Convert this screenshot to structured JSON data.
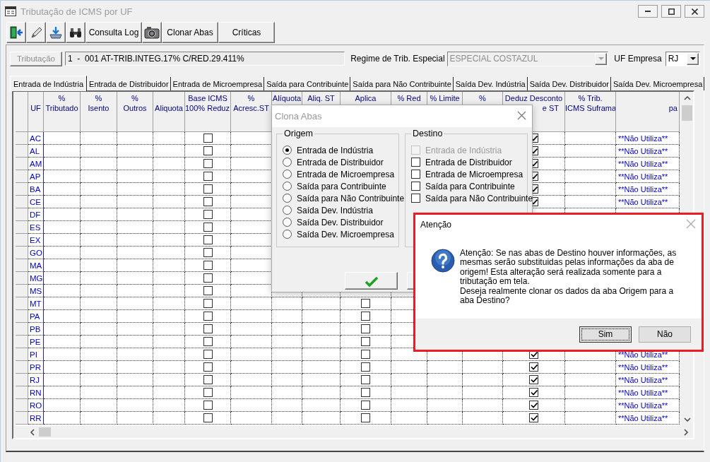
{
  "window": {
    "title": "Tributação de ICMS por UF"
  },
  "toolbar": [
    {
      "kind": "exit"
    },
    {
      "kind": "edit"
    },
    {
      "kind": "download"
    },
    {
      "kind": "binoculars"
    },
    {
      "kind": "text",
      "label": "Consulta Log"
    },
    {
      "kind": "camera"
    },
    {
      "kind": "text",
      "label": "Clonar Abas"
    },
    {
      "kind": "text",
      "label": "Críticas"
    }
  ],
  "header_fields": {
    "tributacao_button": {
      "label": "Tributação",
      "disabled": true
    },
    "tributacao_value": "1  -  001 AT-TRIB.INTEG.17% C/RED.29.411%",
    "regime_label": "Regime de Trib. Especial",
    "regime": {
      "value": "ESPECIAL COSTAZUL",
      "disabled": true
    },
    "uf_label": "UF Empresa",
    "uf": {
      "value": "RJ",
      "disabled": false
    }
  },
  "tabs": [
    {
      "label": "Entrada de Indústria",
      "selected": true
    },
    {
      "label": "Entrada de Distribuidor",
      "selected": false
    },
    {
      "label": "Entrada de Microempresa",
      "selected": false
    },
    {
      "label": "Saída para Contribuinte",
      "selected": false
    },
    {
      "label": "Saída para Não Contribuinte",
      "selected": false
    },
    {
      "label": "Saída Dev. Indústria",
      "selected": false
    },
    {
      "label": "Saída Dev. Distribuidor",
      "selected": false
    },
    {
      "label": "Saída Dev. Microempresa",
      "selected": false
    }
  ],
  "grid": {
    "columns": [
      {
        "kind": "full",
        "lines": [
          "UF"
        ]
      },
      {
        "kind": "full",
        "lines": [
          "%",
          "Tributado"
        ]
      },
      {
        "kind": "full",
        "lines": [
          "%",
          "Isento"
        ]
      },
      {
        "kind": "full",
        "lines": [
          "%",
          "Outros"
        ]
      },
      {
        "kind": "full",
        "lines": [
          "Aliquota"
        ]
      },
      {
        "kind": "full",
        "lines": [
          "Base ICMS",
          "100% Reduz."
        ]
      },
      {
        "kind": "full",
        "lines": [
          "%",
          "Acresc.ST"
        ]
      },
      {
        "kind": "cut",
        "lines": [
          "Alíquota"
        ]
      },
      {
        "kind": "cut",
        "lines": [
          "Aliq. ST"
        ]
      },
      {
        "kind": "cut",
        "lines": [
          "Aplica"
        ]
      },
      {
        "kind": "cut",
        "lines": [
          "% Red"
        ]
      },
      {
        "kind": "cut",
        "lines": [
          "% Limite"
        ]
      },
      {
        "kind": "cut",
        "lines": [
          "%"
        ]
      },
      {
        "kind": "split",
        "lines": [
          "Deduz Desconto",
          "e ST"
        ]
      },
      {
        "kind": "full",
        "lines": [
          "% Trib.",
          "ICMS Suframa"
        ]
      },
      {
        "kind": "edge",
        "lines": [
          "pa"
        ]
      }
    ],
    "rows": [
      {
        "uf": "AC",
        "base_checked": false,
        "deduz_checked": true,
        "note": "**Não Utiliza**"
      },
      {
        "uf": "AL",
        "base_checked": false,
        "deduz_checked": true,
        "note": "**Não Utiliza**"
      },
      {
        "uf": "AM",
        "base_checked": false,
        "deduz_checked": true,
        "note": "**Não Utiliza**"
      },
      {
        "uf": "AP",
        "base_checked": false,
        "deduz_checked": true,
        "note": "**Não Utiliza**"
      },
      {
        "uf": "BA",
        "base_checked": false,
        "deduz_checked": true,
        "note": "**Não Utiliza**"
      },
      {
        "uf": "CE",
        "base_checked": false,
        "deduz_checked": true,
        "note": "**Não Utiliza**"
      },
      {
        "uf": "DF",
        "base_checked": false
      },
      {
        "uf": "ES",
        "base_checked": false
      },
      {
        "uf": "EX",
        "base_checked": false
      },
      {
        "uf": "GO",
        "base_checked": false
      },
      {
        "uf": "MA",
        "base_checked": false
      },
      {
        "uf": "MG",
        "base_checked": false
      },
      {
        "uf": "MS",
        "base_checked": false
      },
      {
        "uf": "MT",
        "base_checked": false,
        "aplica_checked": false
      },
      {
        "uf": "PA",
        "base_checked": false,
        "aplica_checked": false
      },
      {
        "uf": "PB",
        "base_checked": false,
        "aplica_checked": false
      },
      {
        "uf": "PE",
        "base_checked": false,
        "aplica_checked": false
      },
      {
        "uf": "PI",
        "base_checked": false,
        "aplica_checked": false,
        "deduz_checked": true,
        "note": "**Não Utiliza**"
      },
      {
        "uf": "PR",
        "base_checked": false,
        "aplica_checked": false,
        "deduz_checked": true,
        "note": "**Não Utiliza**"
      },
      {
        "uf": "RJ",
        "base_checked": false,
        "aplica_checked": false,
        "deduz_checked": true,
        "note": "**Não Utiliza**"
      },
      {
        "uf": "RN",
        "base_checked": false,
        "aplica_checked": false,
        "deduz_checked": true,
        "note": "**Não Utiliza**"
      },
      {
        "uf": "RO",
        "base_checked": false,
        "aplica_checked": false,
        "deduz_checked": true,
        "note": "**Não Utiliza**"
      },
      {
        "uf": "RR",
        "base_checked": false,
        "aplica_checked": false,
        "deduz_checked": true,
        "note": "**Não Utiliza**"
      }
    ]
  },
  "clone_dialog": {
    "title": "Clona Abas",
    "origin_label": "Origem",
    "origin_options": [
      {
        "label": "Entrada de Indústria",
        "selected": true
      },
      {
        "label": "Entrada de Distribuidor",
        "selected": false
      },
      {
        "label": "Entrada de Microempresa",
        "selected": false
      },
      {
        "label": "Saída para Contribuinte",
        "selected": false
      },
      {
        "label": "Saída para Não Contribuinte",
        "selected": false
      },
      {
        "label": "Saída Dev. Indústria",
        "selected": false
      },
      {
        "label": "Saída Dev. Distribuidor",
        "selected": false
      },
      {
        "label": "Saída Dev. Microempresa",
        "selected": false
      }
    ],
    "destination_label": "Destino",
    "destination_options": [
      {
        "label": "Entrada de Indústria",
        "checked": false,
        "disabled": true
      },
      {
        "label": "Entrada de Distribuidor",
        "checked": false,
        "disabled": false
      },
      {
        "label": "Entrada de Microempresa",
        "checked": false,
        "disabled": false
      },
      {
        "label": "Saída para Contribuinte",
        "checked": false,
        "disabled": false
      },
      {
        "label": "Saída para Não Contribuinte",
        "checked": false,
        "disabled": false
      }
    ]
  },
  "alert_dialog": {
    "title": "Atenção",
    "paragraphs": [
      "Atenção: Se nas abas de Destino houver informações, as mesmas serão substituidas pelas informações da aba de origem! Esta alteração será realizada somente para a tributação em tela.",
      "Deseja realmente clonar os dados da aba Origem para a aba Destino?"
    ],
    "buttons": [
      {
        "label": "Sim",
        "focused": true
      },
      {
        "label": "Não",
        "focused": false
      }
    ]
  }
}
